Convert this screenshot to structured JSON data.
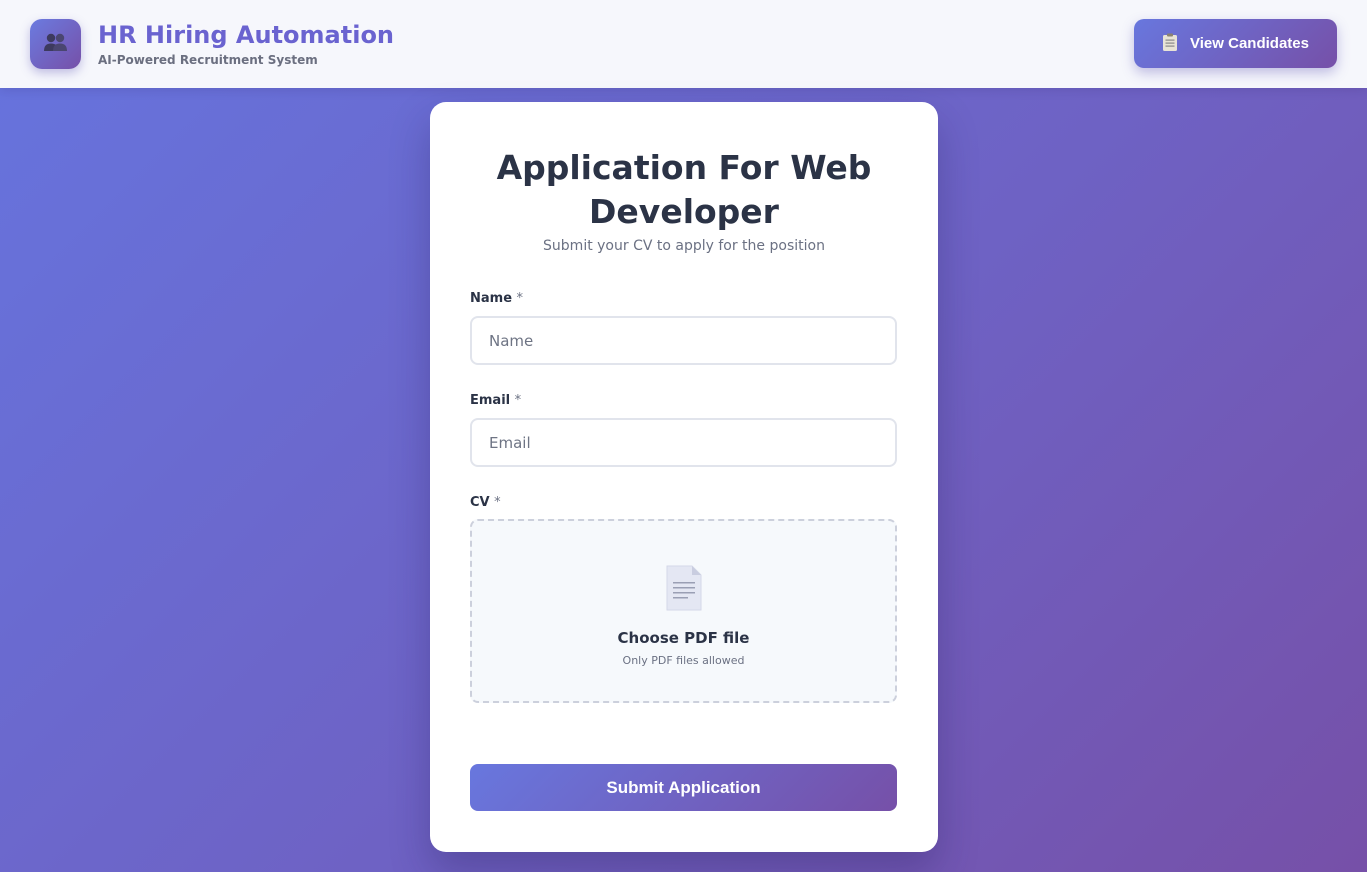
{
  "header": {
    "title": "HR Hiring Automation",
    "subtitle": "AI-Powered Recruitment System",
    "logo_icon": "users-icon",
    "view_candidates_label": "View Candidates",
    "view_candidates_icon": "clipboard-icon"
  },
  "form": {
    "title": "Application For Web Developer",
    "subtitle": "Submit your CV to apply for the position",
    "name_label": "Name",
    "name_placeholder": "Name",
    "email_label": "Email",
    "email_placeholder": "Email",
    "cv_label": "CV",
    "required_mark": "*",
    "dropzone_title": "Choose PDF file",
    "dropzone_hint": "Only PDF files allowed",
    "dropzone_icon": "document-icon",
    "submit_label": "Submit Application"
  },
  "colors": {
    "accent_start": "#6877de",
    "accent_end": "#7650a8",
    "title_text": "#2b3346",
    "header_title": "#6a63d0"
  }
}
